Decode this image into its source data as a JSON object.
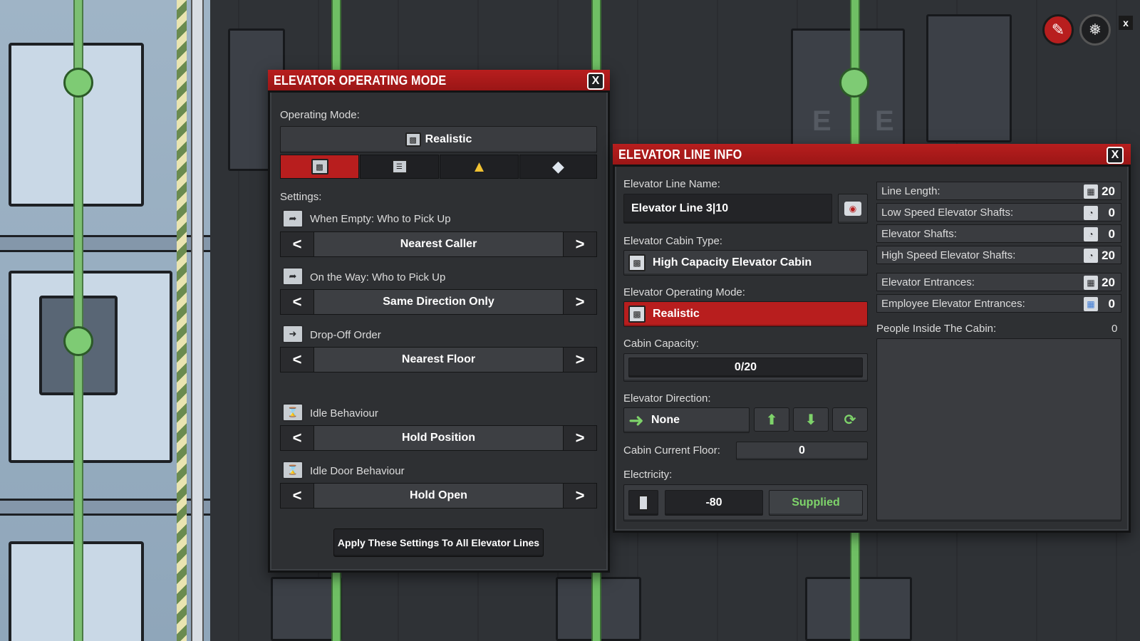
{
  "colors": {
    "header_red": "#b81e1e",
    "active_red": "#b81e1e",
    "panel_bg": "#2e3033",
    "supplied_green": "#7ed36a",
    "node_green": "#7ecb74"
  },
  "operating_mode_panel": {
    "title": "ELEVATOR OPERATING MODE",
    "close_label": "X",
    "operating_mode_label": "Operating Mode:",
    "current_mode": "Realistic",
    "mode_tabs": [
      {
        "icon": "realistic-mode-icon",
        "active": true
      },
      {
        "icon": "server-mode-icon",
        "active": false
      },
      {
        "icon": "broom-mode-icon",
        "active": false
      },
      {
        "icon": "gem-mode-icon",
        "active": false
      }
    ],
    "settings_label": "Settings:",
    "settings": [
      {
        "label": "When Empty: Who to Pick Up",
        "value": "Nearest Caller",
        "icon": "pickup-arrow-icon"
      },
      {
        "label": "On the Way: Who to Pick Up",
        "value": "Same Direction Only",
        "icon": "pickup-arrow-icon"
      },
      {
        "label": "Drop-Off Order",
        "value": "Nearest Floor",
        "icon": "dropoff-arrow-icon"
      },
      {
        "label": "Idle Behaviour",
        "value": "Hold Position",
        "icon": "hourglass-icon"
      },
      {
        "label": "Idle Door Behaviour",
        "value": "Hold Open",
        "icon": "hourglass-icon"
      }
    ],
    "prev_label": "<",
    "next_label": ">",
    "apply_button": "Apply These Settings To All Elevator Lines"
  },
  "line_info_panel": {
    "title": "ELEVATOR LINE INFO",
    "close_label": "X",
    "line_name_label": "Elevator Line Name:",
    "line_name": "Elevator Line 3|10",
    "cabin_type_label": "Elevator Cabin Type:",
    "cabin_type": "High Capacity Elevator Cabin",
    "operating_mode_label": "Elevator Operating Mode:",
    "operating_mode": "Realistic",
    "capacity_label": "Cabin Capacity:",
    "capacity": "0/20",
    "direction_label": "Elevator Direction:",
    "direction": "None",
    "current_floor_label": "Cabin Current Floor:",
    "current_floor": "0",
    "electricity_label": "Electricity:",
    "electricity_value": "-80",
    "electricity_status": "Supplied",
    "stats": [
      {
        "label": "Line Length:",
        "value": "20",
        "icon": "shaft-length-icon"
      },
      {
        "label": "Low Speed Elevator Shafts:",
        "value": "0",
        "icon": "low-speed-shaft-icon"
      },
      {
        "label": "Elevator Shafts:",
        "value": "0",
        "icon": "shaft-icon"
      },
      {
        "label": "High Speed Elevator Shafts:",
        "value": "20",
        "icon": "high-speed-shaft-icon"
      },
      {
        "label": "Elevator Entrances:",
        "value": "20",
        "icon": "entrance-icon"
      },
      {
        "label": "Employee Elevator Entrances:",
        "value": "0",
        "icon": "employee-entrance-icon"
      }
    ],
    "people_label": "People Inside The Cabin:",
    "people_count": "0"
  },
  "hud": {
    "close_label": "x"
  }
}
